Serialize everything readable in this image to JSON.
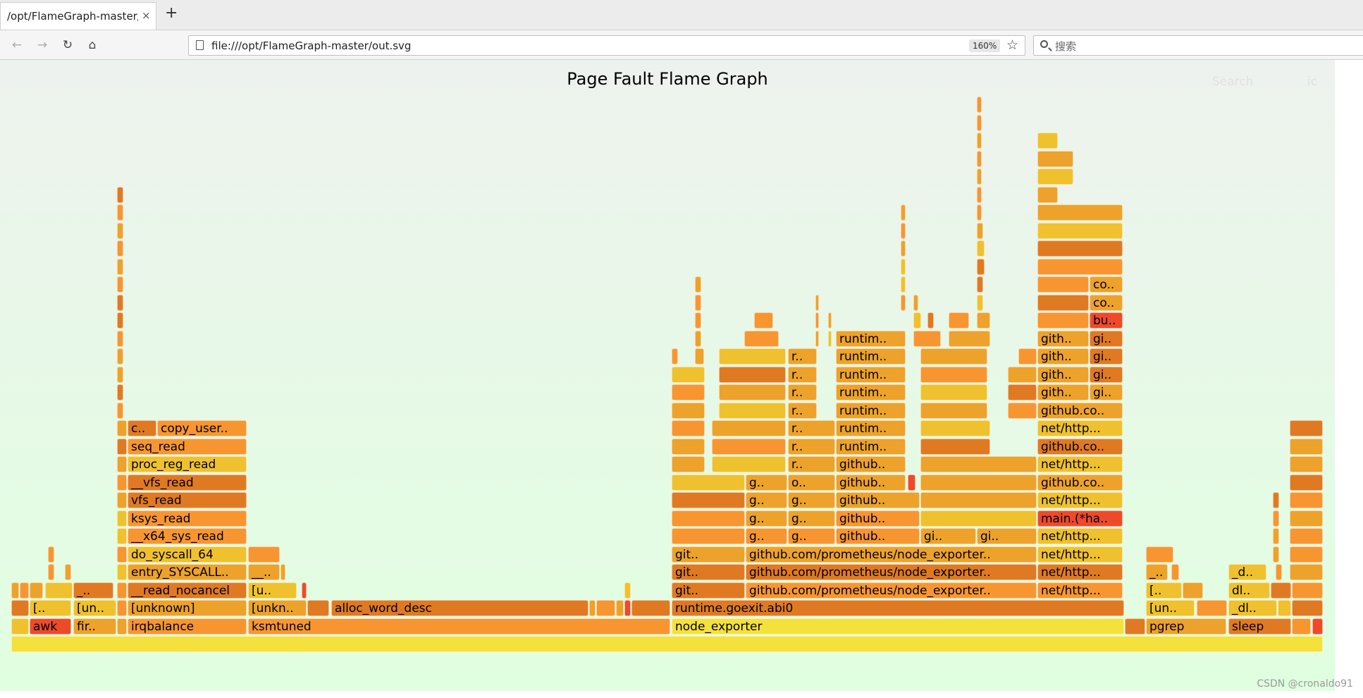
{
  "tab": {
    "title": "/opt/FlameGraph-master/out.",
    "close": "×",
    "new_tab": "+"
  },
  "nav": {
    "back": "←",
    "forward": "→",
    "reload": "↻",
    "home": "⌂"
  },
  "urlbar": {
    "url": "file:///opt/FlameGraph-master/out.svg",
    "zoom": "160%",
    "bookmark": "☆"
  },
  "search": {
    "placeholder": "搜索"
  },
  "flamegraph": {
    "title": "Page Fault Flame Graph",
    "search_label": "Search",
    "ic_label": "ic",
    "colors": {
      "base": "#f5e13b",
      "orange": "#f79631",
      "amber": "#eda22b",
      "red": "#ee4a2a",
      "yellow": "#f0c12e",
      "dark": "#e07a22"
    },
    "labels": {
      "all": "",
      "awk": "awk",
      "fir": "fir..",
      "irqbalance": "irqbalance",
      "ksmtuned": "ksmtuned",
      "node_exporter": "node_exporter",
      "pgrep": "pgrep",
      "sleep": "sleep",
      "lb1": "[..",
      "un1": "[un..",
      "unknown_irq": "[unknown]",
      "unkn_ksm": "[unkn..",
      "alloc": "alloc_word_desc",
      "goexit": "runtime.goexit.abi0",
      "un_pg": "[un..",
      "dl_sleep": "_dl..",
      "us_awk": "_..",
      "read_nocancel": "__read_nocancel",
      "u_ksm": "[u..",
      "git1": "git..",
      "prom1": "github.com/prometheus/node_exporter..",
      "nethttp1": "net/http...",
      "lb_pg": "[..",
      "dl2": "dl..",
      "entry_syscall": "entry_SYSCALL..",
      "us_ksm": "__..",
      "git2": "git..",
      "prom2": "github.com/prometheus/node_exporter..",
      "nethttp2": "net/http...",
      "us_pg": "_..",
      "d_sleep": "_d..",
      "do_syscall": "do_syscall_64",
      "git3": "git..",
      "prom3": "github.com/prometheus/node_exporter..",
      "nethttp3": "net/http...",
      "x64_sys_read": "__x64_sys_read",
      "g4": "g..",
      "g4b": "g..",
      "github4": "github..",
      "gi4": "gi..",
      "gi4b": "gi..",
      "nethttp4": "net/http...",
      "ksys_read": "ksys_read",
      "g5": "g..",
      "g5b": "g..",
      "github5": "github..",
      "main_ha": "main.(*ha..",
      "vfs_read": "vfs_read",
      "g6": "g..",
      "g6b": "g..",
      "github6": "github..",
      "nethttp6": "net/http...",
      "__vfs_read": "__vfs_read",
      "g7": "g..",
      "o7": "o..",
      "github7": "github..",
      "githubco7": "github.co..",
      "proc_reg_read": "proc_reg_read",
      "r8": "r..",
      "github8": "github..",
      "nethttp8": "net/http...",
      "seq_read": "seq_read",
      "r9": "r..",
      "runtim9": "runtim..",
      "githubco9": "github.co..",
      "c10": "c..",
      "copy_user": "copy_user..",
      "r10": "r..",
      "runtim10": "runtim..",
      "nethttp10": "net/http...",
      "r11": "r..",
      "runtim11": "runtim..",
      "githubco11": "github.co..",
      "r12": "r..",
      "runtim12": "runtim..",
      "gith12": "gith..",
      "gi12": "gi..",
      "r13": "r..",
      "runtim13": "runtim..",
      "gith13": "gith..",
      "gi13": "gi..",
      "r14": "r..",
      "runtim14": "runtim..",
      "gith14": "gith..",
      "gi14": "gi..",
      "runtim15": "runtim..",
      "gith15": "gith..",
      "gi15": "gi..",
      "bu16": "bu..",
      "co17": "co..",
      "co18": "co.."
    }
  },
  "watermark": "CSDN @cronaldo91"
}
